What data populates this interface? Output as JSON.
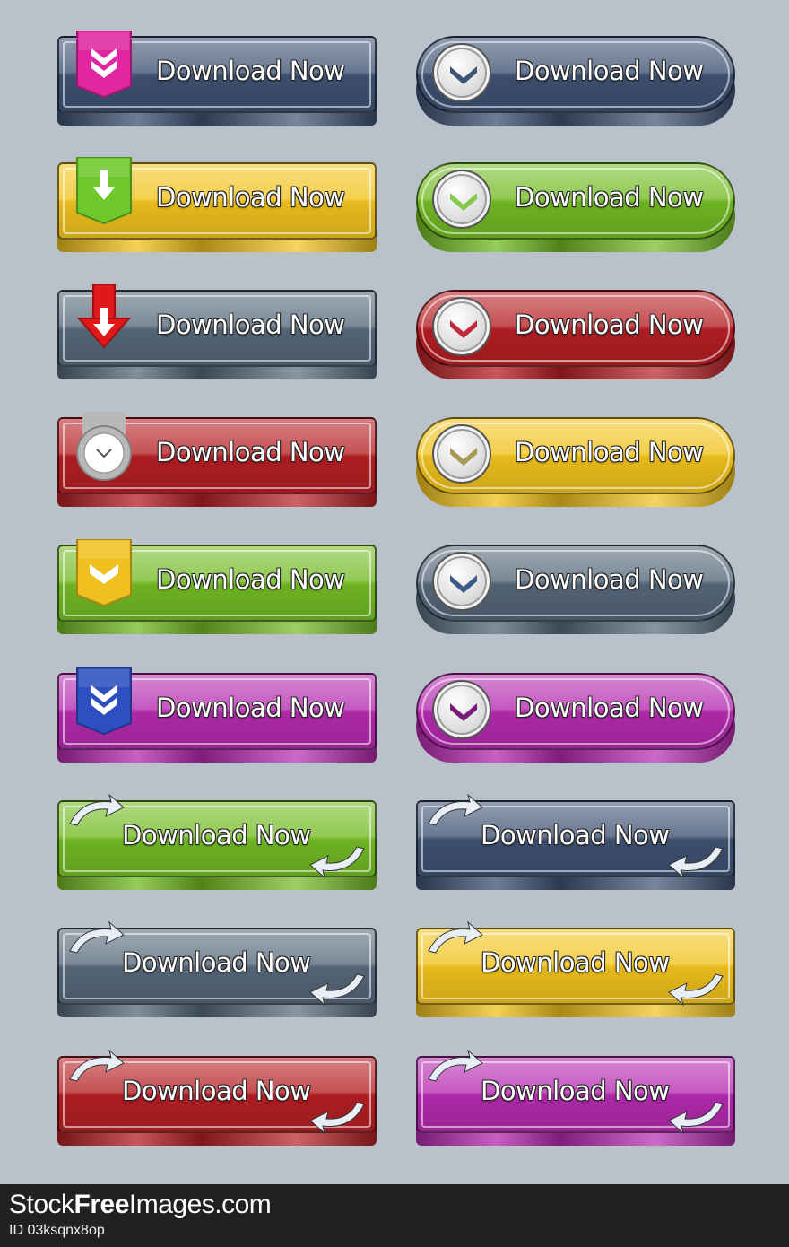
{
  "buttons": [
    {
      "label": "Download Now",
      "color": "#3e5273",
      "accent": "#e0279f",
      "style": "rect",
      "icon": "double-chevron-down",
      "col": "left",
      "row": 1
    },
    {
      "label": "Download Now",
      "color": "#3e5273",
      "accent": "#3e5273",
      "style": "pill",
      "icon": "chevron-down",
      "col": "right",
      "row": 1
    },
    {
      "label": "Download Now",
      "color": "#f1c31d",
      "accent": "#6ec82a",
      "style": "rect",
      "icon": "arrow-down",
      "col": "left",
      "row": 2
    },
    {
      "label": "Download Now",
      "color": "#73bb24",
      "accent": "#86c84a",
      "style": "pill",
      "icon": "chevron-down",
      "col": "right",
      "row": 2
    },
    {
      "label": "Download Now",
      "color": "#56687a",
      "accent": "#e01818",
      "style": "rect",
      "icon": "arrow-down-red",
      "col": "left",
      "row": 3
    },
    {
      "label": "Download Now",
      "color": "#b51f24",
      "accent": "#c02a3a",
      "style": "pill",
      "icon": "chevron-down",
      "col": "right",
      "row": 3
    },
    {
      "label": "Download Now",
      "color": "#b51f24",
      "accent": "#b8b8b8",
      "style": "rect",
      "icon": "circle-chevron-down",
      "col": "left",
      "row": 4
    },
    {
      "label": "Download Now",
      "color": "#f1c31d",
      "accent": "#a89a55",
      "style": "pill",
      "icon": "chevron-down",
      "col": "right",
      "row": 4
    },
    {
      "label": "Download Now",
      "color": "#73bb24",
      "accent": "#f0c020",
      "style": "rect",
      "icon": "chevron-down",
      "col": "left",
      "row": 5
    },
    {
      "label": "Download Now",
      "color": "#56687a",
      "accent": "#3e5a8a",
      "style": "pill",
      "icon": "chevron-down",
      "col": "right",
      "row": 5
    },
    {
      "label": "Download Now",
      "color": "#b52ab0",
      "accent": "#2e4fc0",
      "style": "rect",
      "icon": "double-chevron-down",
      "col": "left",
      "row": 6
    },
    {
      "label": "Download Now",
      "color": "#b52ab0",
      "accent": "#7a1a78",
      "style": "pill",
      "icon": "chevron-down",
      "col": "right",
      "row": 6
    },
    {
      "label": "Download Now",
      "color": "#73bb24",
      "accent": "#e8eef5",
      "style": "curved-arrows",
      "icon": "curved-arrows",
      "col": "left",
      "row": 7
    },
    {
      "label": "Download Now",
      "color": "#3e5273",
      "accent": "#e8eef5",
      "style": "curved-arrows",
      "icon": "curved-arrows",
      "col": "right",
      "row": 7
    },
    {
      "label": "Download Now",
      "color": "#56687a",
      "accent": "#e8eef5",
      "style": "curved-arrows",
      "icon": "curved-arrows",
      "col": "left",
      "row": 8
    },
    {
      "label": "Download Now",
      "color": "#f1c31d",
      "accent": "#e8eef5",
      "style": "curved-arrows",
      "icon": "curved-arrows",
      "col": "right",
      "row": 8
    },
    {
      "label": "Download Now",
      "color": "#b51f24",
      "accent": "#e8eef5",
      "style": "curved-arrows",
      "icon": "curved-arrows",
      "col": "left",
      "row": 9
    },
    {
      "label": "Download Now",
      "color": "#b52ab0",
      "accent": "#e8eef5",
      "style": "curved-arrows",
      "icon": "curved-arrows",
      "col": "right",
      "row": 9
    }
  ],
  "footer": {
    "brand_prefix": "Stock",
    "brand_bold": "Free",
    "brand_suffix": "Images.com",
    "image_id": "ID 03ksqnx8op"
  },
  "colors": {
    "background": "#b9c2cb",
    "footer_background": "#212121"
  }
}
